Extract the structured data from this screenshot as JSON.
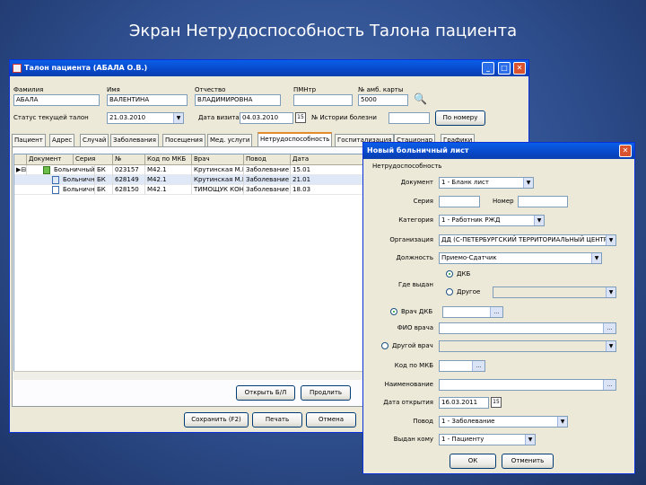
{
  "slide_title": "Экран Нетрудоспособность Талона пациента",
  "main": {
    "title": "Талон пациента (АБАЛА О.В.)",
    "fields": [
      {
        "label": "Фамилия",
        "value": "АБАЛА"
      },
      {
        "label": "Имя",
        "value": "ВАЛЕНТИНА"
      },
      {
        "label": "Отчество",
        "value": "ВЛАДИМИРОВНА"
      },
      {
        "label": "ПМНтр",
        "value": ""
      },
      {
        "label": "№ амб. карты",
        "value": "5000"
      }
    ],
    "status_label": "Статус текущей талон",
    "status_value": "21.03.2010",
    "date_label": "Дата визита",
    "date_value": "04.03.2010",
    "series_label": "№ Истории болезни",
    "series_value": "",
    "right_button": "По номеру",
    "tabs": [
      "Пациент",
      "Адрес",
      "Случай",
      "Заболевания",
      "Посещения",
      "Мед. услуги",
      "Нетрудоспособность",
      "Госпитализация",
      "Стационар",
      "Графики"
    ],
    "grid_headers": [
      "",
      "Документ",
      "Серия",
      "№",
      "Код по МКБ",
      "Врач",
      "Повод",
      "Дата"
    ],
    "grid_rows": [
      [
        "Больничный лист",
        "БК",
        "023157",
        "М42.1",
        "Крутинская М.Б.",
        "Заболевание",
        "15.01"
      ],
      [
        "Больничный лист",
        "БК",
        "628149",
        "М42.1",
        "Крутинская М.Б.",
        "Заболевание",
        "21.01"
      ],
      [
        "Больничный лист",
        "БК",
        "628150",
        "М42.1",
        "ТИМОЩУК КОН...",
        "Заболевание",
        "18.03"
      ]
    ],
    "open_button": "Открыть Б/Л",
    "print_button": "Продлить",
    "save_button": "Сохранить (F2)",
    "print2_button": "Печать",
    "cancel_button": "Отмена"
  },
  "dialog": {
    "title": "Новый больничный лист",
    "group_label": "Нетрудоспособность",
    "doc_label": "Документ",
    "doc_value": "1 - Бланк лист",
    "series_label": "Серия",
    "series_value": "",
    "number_label": "Номер",
    "number_value": "",
    "category_label": "Категория",
    "category_value": "1 - Работник РЖД",
    "org_label": "Организация",
    "org_value": "ДД (С-ПЕТЕРБУРГСКИЙ ТЕРРИТОРИАЛЬНЫЙ ЦЕНТР",
    "post_label": "Должность",
    "post_value": "Приемо-Сдатчик",
    "issued_label": "Где выдан",
    "issued_option1": "ДКБ",
    "issued_option2": "Другое",
    "doctor_option": "Врач ДКБ",
    "fio_label": "ФИО врача",
    "other_doctor_option": "Другой врач",
    "mkb_label": "Код по МКБ",
    "mkb_value": "",
    "name_label": "Наименование",
    "open_date_label": "Дата открытия",
    "open_date_value": "16.03.2011",
    "reason_label": "Повод",
    "reason_value": "1 - Заболевание",
    "issued_to_label": "Выдан кому",
    "issued_to_value": "1 - Пациенту",
    "ok_button": "ОК",
    "cancel_button": "Отменить"
  }
}
